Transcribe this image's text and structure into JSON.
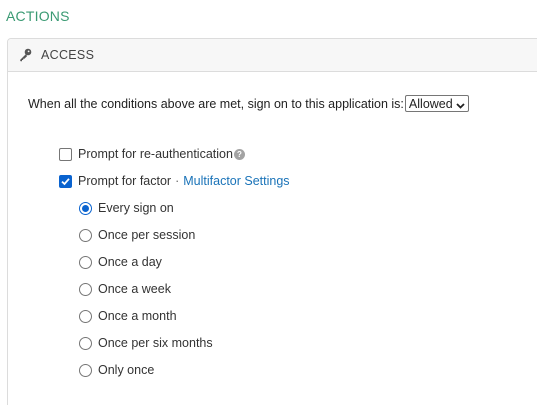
{
  "section": {
    "title": "ACTIONS"
  },
  "panel": {
    "header_label": "ACCESS",
    "header_icon": "key-icon"
  },
  "rule": {
    "text": "When all the conditions above are met, sign on to this application is:",
    "access_select": {
      "selected": "Allowed",
      "icon": "chevron-down-icon"
    }
  },
  "options": {
    "reauth": {
      "label": "Prompt for re-authentication",
      "checked": false,
      "help_icon": "help-icon",
      "help_glyph": "?"
    },
    "factor": {
      "label": "Prompt for factor",
      "separator": "·",
      "link_label": "Multifactor Settings",
      "checked": true
    }
  },
  "frequency": {
    "selected_index": 0,
    "items": [
      {
        "label": "Every sign on"
      },
      {
        "label": "Once per session"
      },
      {
        "label": "Once a day"
      },
      {
        "label": "Once a week"
      },
      {
        "label": "Once a month"
      },
      {
        "label": "Once per six months"
      },
      {
        "label": "Only once"
      }
    ]
  },
  "colors": {
    "section_title": "#3a9a73",
    "link": "#1a73b8",
    "control_accent": "#0a63cf"
  }
}
